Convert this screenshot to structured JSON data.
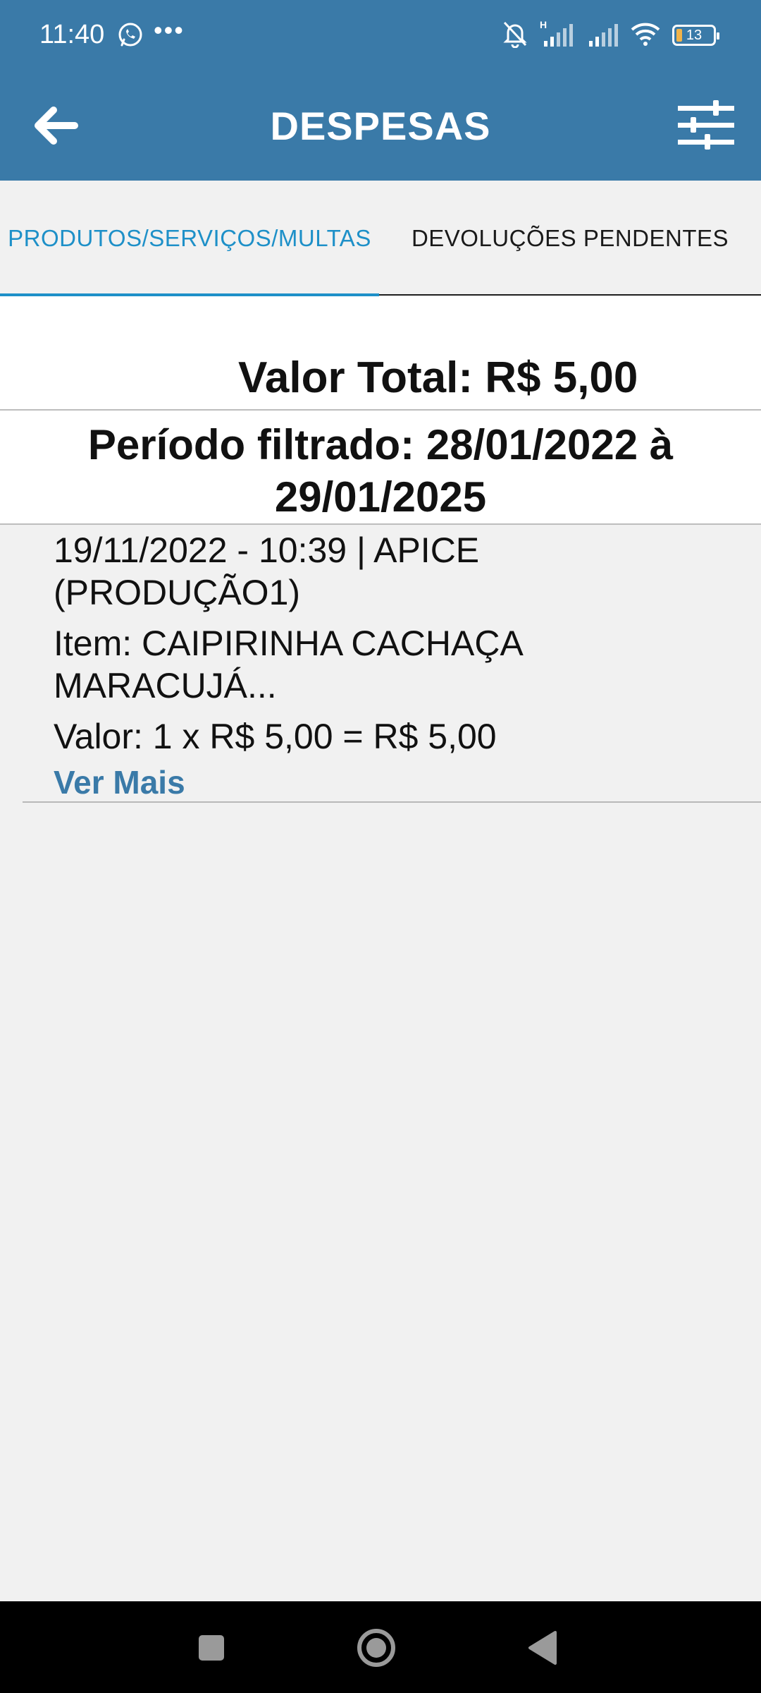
{
  "status_bar": {
    "time": "11:40",
    "battery": "13",
    "icons": [
      "whatsapp-icon",
      "more-icon",
      "notifications-off-icon",
      "signal-icon",
      "signal-icon",
      "wifi-icon",
      "battery-icon"
    ]
  },
  "app_bar": {
    "title": "DESPESAS",
    "back_icon": "arrow-left-icon",
    "filter_icon": "sliders-icon"
  },
  "tabs": [
    {
      "label": "PRODUTOS/SERVIÇOS/MULTAS",
      "active": true
    },
    {
      "label": "DEVOLUÇÕES PENDENTES",
      "active": false
    }
  ],
  "summary": {
    "total": "Valor Total: R$ 5,00",
    "period": "Período filtrado: 28/01/2022 à 29/01/2025"
  },
  "items": [
    {
      "line1": "19/11/2022 - 10:39 | APICE (PRODUÇÃO1)",
      "line2": "Item: CAIPIRINHA CACHAÇA MARACUJÁ...",
      "line3": "Valor: 1 x R$ 5,00 = R$ 5,00",
      "link": "Ver Mais"
    }
  ],
  "colors": {
    "primary": "#3a7aa8",
    "tab_active": "#1e90c8",
    "background": "#f1f1f1"
  }
}
